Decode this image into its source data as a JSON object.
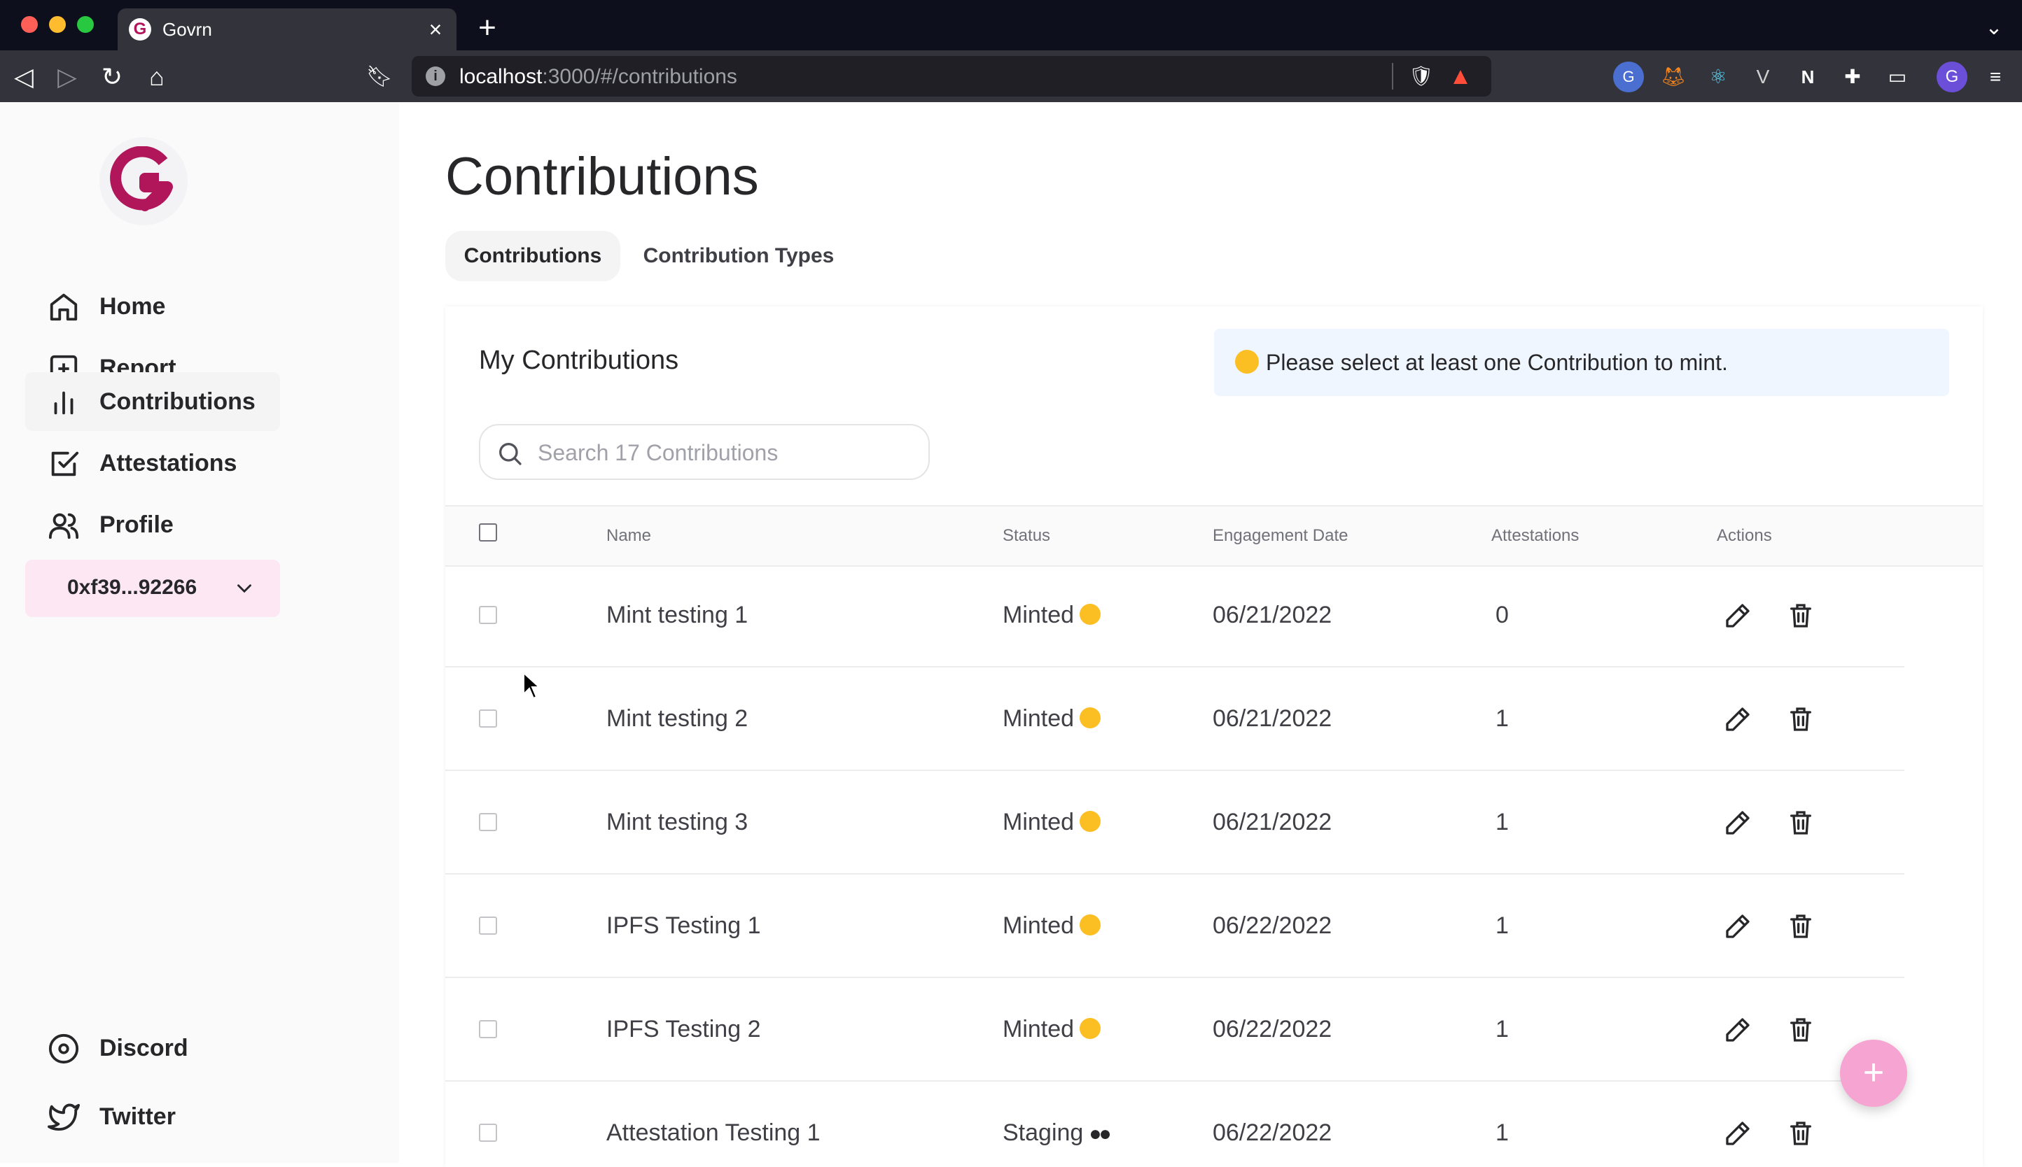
{
  "browser": {
    "tab_title": "Govrn",
    "url_host": "localhost",
    "url_path": ":3000/#/contributions"
  },
  "sidebar": {
    "items": [
      {
        "label": "Home",
        "icon": "home-icon"
      },
      {
        "label": "Report",
        "icon": "plus-square-icon"
      },
      {
        "label": "Contributions",
        "icon": "bar-chart-icon",
        "active": true
      },
      {
        "label": "Attestations",
        "icon": "check-square-icon"
      },
      {
        "label": "Profile",
        "icon": "users-icon"
      }
    ],
    "wallet_address": "0xf39...92266",
    "footer_items": [
      {
        "label": "Discord",
        "icon": "discord-icon"
      },
      {
        "label": "Twitter",
        "icon": "twitter-icon"
      }
    ]
  },
  "main": {
    "title": "Contributions",
    "tabs": [
      {
        "label": "Contributions",
        "active": true
      },
      {
        "label": "Contribution Types",
        "active": false
      }
    ],
    "card_title": "My Contributions",
    "notice": "Please select at least one Contribution to mint.",
    "search_placeholder": "Search 17 Contributions",
    "table": {
      "headers": [
        "Name",
        "Status",
        "Engagement Date",
        "Attestations",
        "Actions"
      ],
      "rows": [
        {
          "name": "Mint testing 1",
          "status": "Minted",
          "status_emoji": "slight-smile",
          "date": "06/21/2022",
          "attestations": "0"
        },
        {
          "name": "Mint testing 2",
          "status": "Minted",
          "status_emoji": "slight-smile",
          "date": "06/21/2022",
          "attestations": "1"
        },
        {
          "name": "Mint testing 3",
          "status": "Minted",
          "status_emoji": "slight-smile",
          "date": "06/21/2022",
          "attestations": "1"
        },
        {
          "name": "IPFS Testing 1",
          "status": "Minted",
          "status_emoji": "slight-smile",
          "date": "06/22/2022",
          "attestations": "1"
        },
        {
          "name": "IPFS Testing 2",
          "status": "Minted",
          "status_emoji": "slight-smile",
          "date": "06/22/2022",
          "attestations": "1"
        },
        {
          "name": "Attestation Testing 1",
          "status": "Staging",
          "status_emoji": "eyes",
          "date": "06/22/2022",
          "attestations": "1"
        }
      ]
    }
  },
  "fab_label": "+",
  "colors": {
    "brand": "#b1155a",
    "accent_pink": "#f6a4d2",
    "wallet_bg": "#fce7f3",
    "notice_bg": "#eff6ff"
  }
}
